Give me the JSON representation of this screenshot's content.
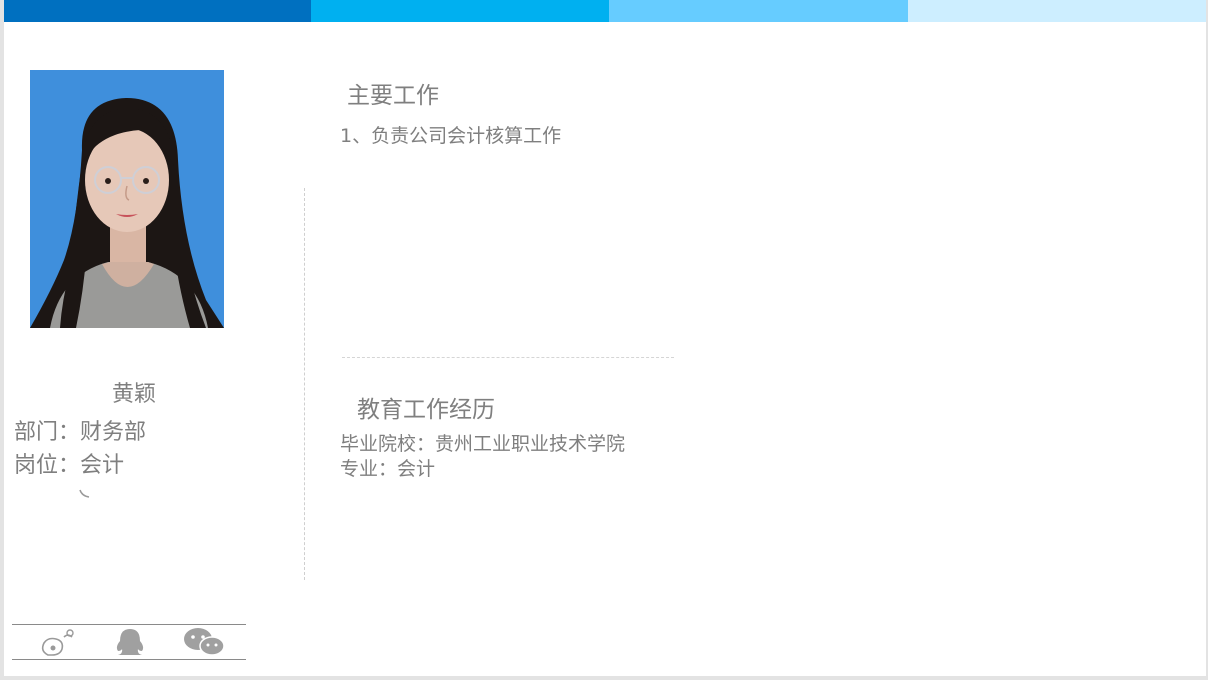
{
  "colors": {
    "bar1": "#0070c0",
    "bar2": "#00b0f0",
    "bar3": "#66ccff",
    "bar4": "#cdeeff",
    "text_gray": "#7f7f7f",
    "photo_bg": "#3f8fdc"
  },
  "profile": {
    "name": "黄颖",
    "department": "部门：财务部",
    "position": "岗位：会计"
  },
  "work": {
    "title": "主要工作",
    "items": [
      "1、负责公司会计核算工作"
    ]
  },
  "education": {
    "title": "教育工作经历",
    "school": "毕业院校：贵州工业职业技术学院",
    "major": "专业：会计"
  },
  "social_icons": [
    "weibo-icon",
    "qq-icon",
    "wechat-icon"
  ]
}
